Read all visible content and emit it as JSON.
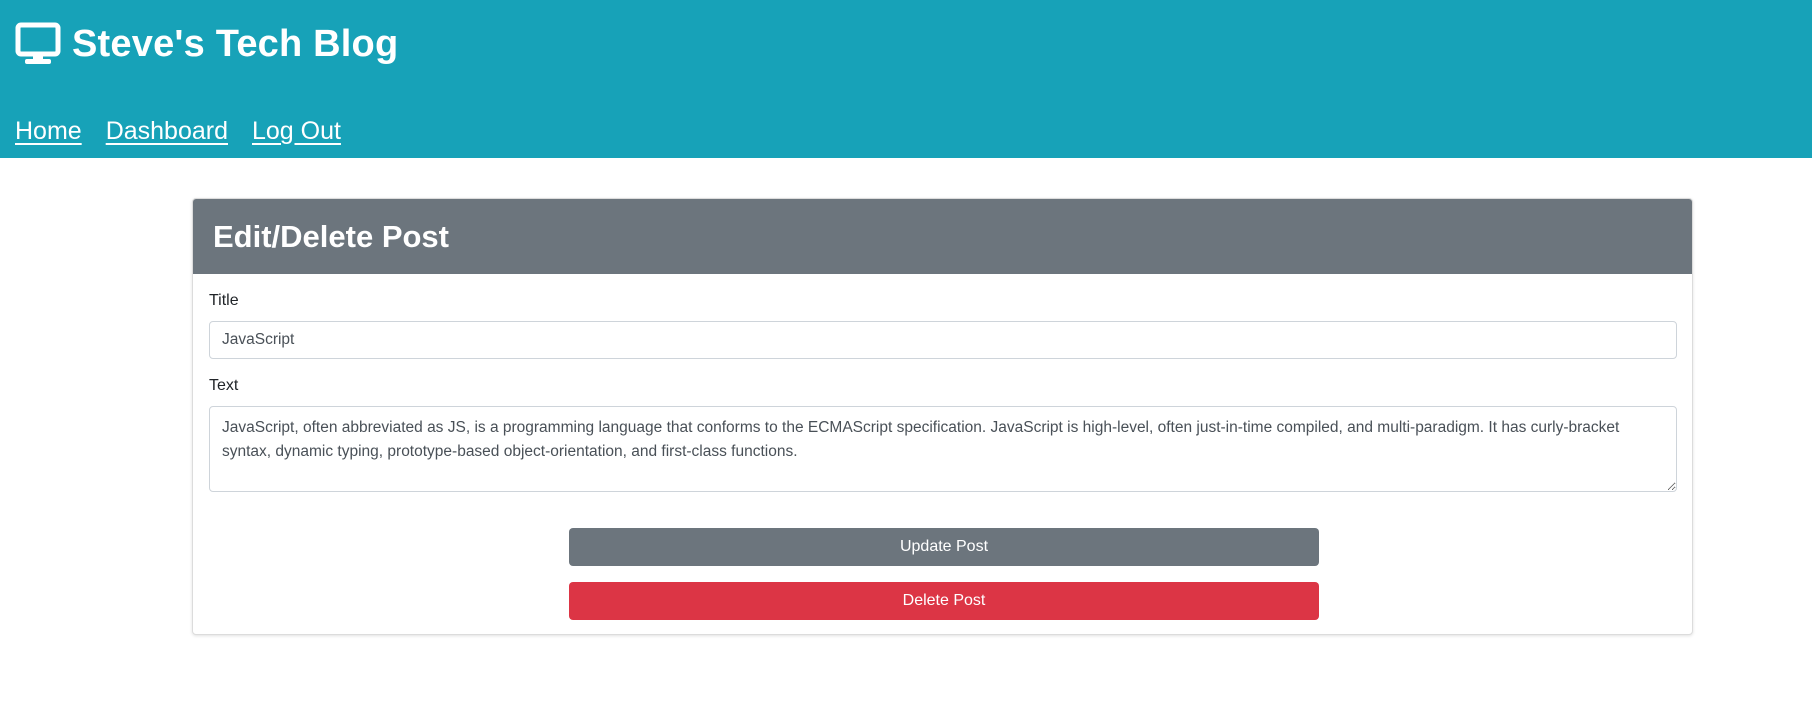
{
  "header": {
    "brand_icon": "desktop-monitor-icon",
    "title": "Steve's Tech Blog",
    "nav": {
      "home": "Home",
      "dashboard": "Dashboard",
      "logout": "Log Out"
    }
  },
  "card": {
    "title": "Edit/Delete Post",
    "title_label": "Title",
    "title_value": "JavaScript",
    "text_label": "Text",
    "text_value": "JavaScript, often abbreviated as JS, is a programming language that conforms to the ECMAScript specification. JavaScript is high-level, often just-in-time compiled, and multi-paradigm. It has curly-bracket syntax, dynamic typing, prototype-based object-orientation, and first-class functions.",
    "update_label": "Update Post",
    "delete_label": "Delete Post"
  },
  "colors": {
    "header_bg": "#17a2b8",
    "card_header_bg": "#6c757d",
    "update_button": "#6c757d",
    "delete_button": "#dc3545"
  }
}
